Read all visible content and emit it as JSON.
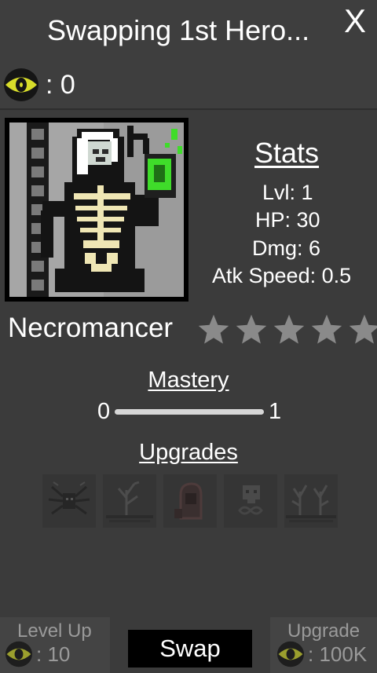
{
  "header": {
    "title": "Swapping 1st Hero...",
    "close_label": "X"
  },
  "currency": {
    "icon": "eye-coin-icon",
    "value": ": 0"
  },
  "stats": {
    "title": "Stats",
    "level": "Lvl: 1",
    "hp": "HP: 30",
    "damage": "Dmg: 6",
    "attack_speed": "Atk Speed: 0.5"
  },
  "hero": {
    "name": "Necromancer",
    "portrait_icon": "necromancer-skeleton-icon",
    "stars_total": 5,
    "stars_filled": 0
  },
  "mastery": {
    "title": "Mastery",
    "min": "0",
    "max": "1",
    "progress": 0
  },
  "upgrades": {
    "title": "Upgrades",
    "slots": [
      {
        "icon": "spider-skull-icon",
        "locked": true
      },
      {
        "icon": "dead-tree-icon",
        "locked": true
      },
      {
        "icon": "hooded-figure-icon",
        "locked": true
      },
      {
        "icon": "skull-infinity-icon",
        "locked": true
      },
      {
        "icon": "twin-dead-trees-icon",
        "locked": true
      }
    ]
  },
  "footer": {
    "level_up": {
      "label": "Level Up",
      "cost": ": 10"
    },
    "swap_label": "Swap",
    "upgrade": {
      "label": "Upgrade",
      "cost": ": 100K"
    }
  },
  "colors": {
    "background": "#3b3b3b",
    "eye_coin": "#d7dc2a",
    "star_empty": "#8a8a8a",
    "necro_green": "#3fdc2a",
    "bone": "#efe6b4"
  }
}
